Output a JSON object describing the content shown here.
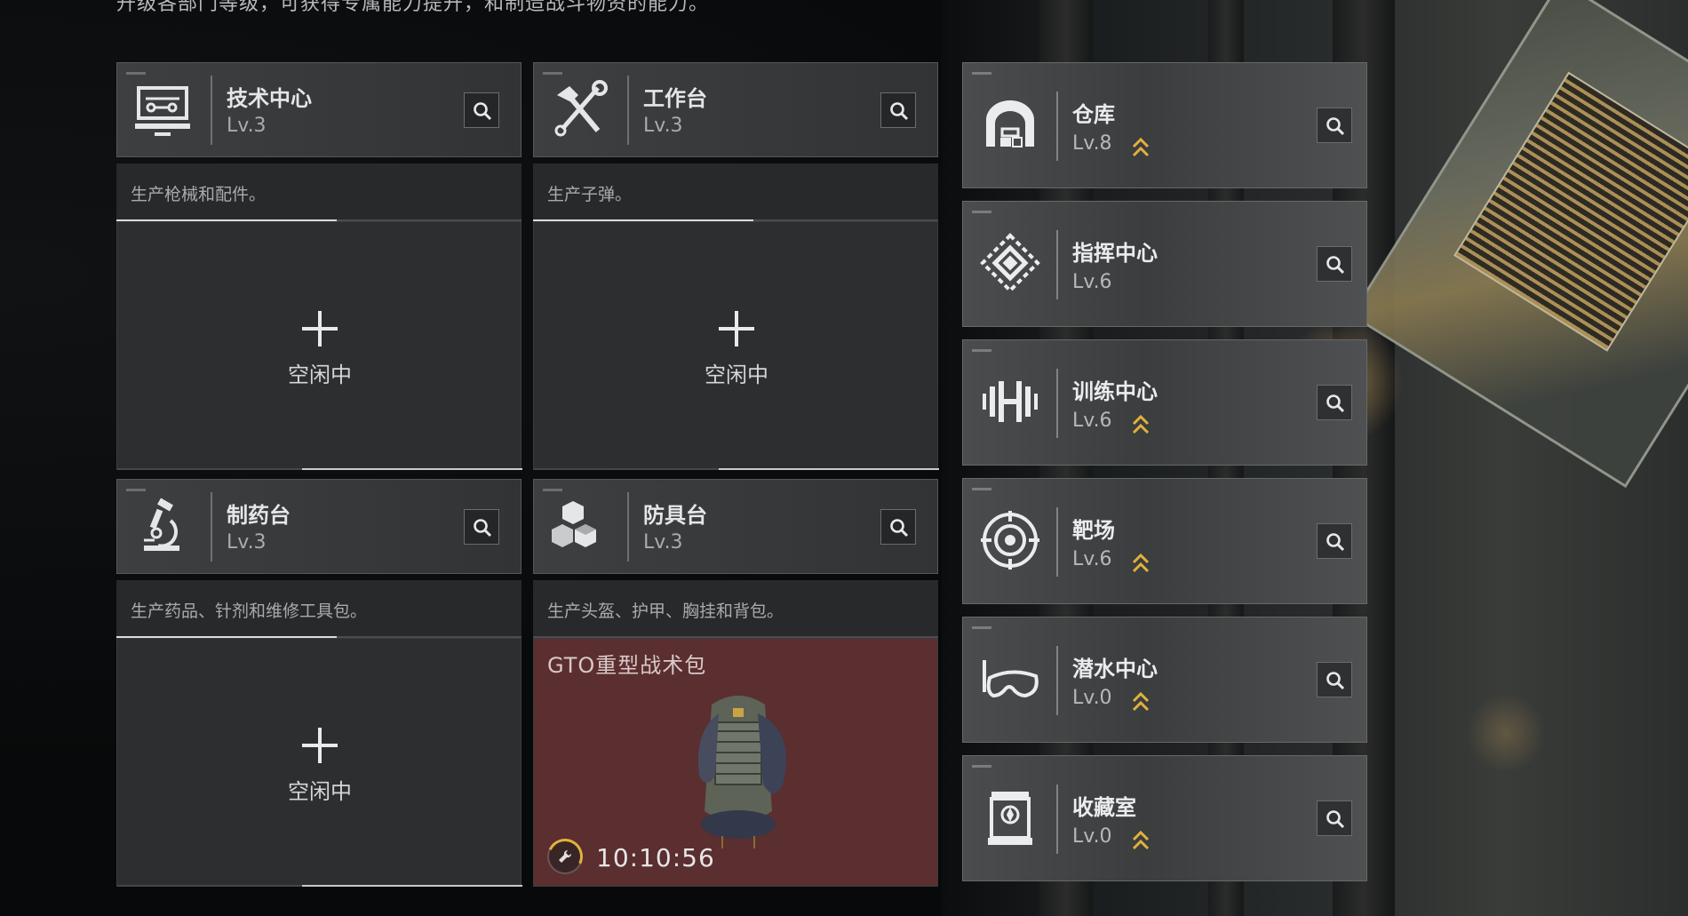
{
  "header": {
    "subtitle": "升级各部门等级，可获得专属能力提升，和制造战斗物资的能力。"
  },
  "production": [
    {
      "name": "技术中心",
      "level": "Lv.3",
      "description": "生产枪械和配件。",
      "status": "空闲中",
      "icon": "computer-icon"
    },
    {
      "name": "工作台",
      "level": "Lv.3",
      "description": "生产子弹。",
      "status": "空闲中",
      "icon": "tools-icon"
    },
    {
      "name": "制药台",
      "level": "Lv.3",
      "description": "生产药品、针剂和维修工具包。",
      "status": "空闲中",
      "icon": "microscope-icon"
    },
    {
      "name": "防具台",
      "level": "Lv.3",
      "description": "生产头盔、护甲、胸挂和背包。",
      "item": "GTO重型战术包",
      "timer": "10:10:56",
      "icon": "boxes-icon"
    }
  ],
  "facilities": [
    {
      "name": "仓库",
      "level": "Lv.8",
      "upgradable": true,
      "icon": "warehouse-icon"
    },
    {
      "name": "指挥中心",
      "level": "Lv.6",
      "upgradable": false,
      "icon": "command-icon"
    },
    {
      "name": "训练中心",
      "level": "Lv.6",
      "upgradable": true,
      "icon": "dumbbell-icon"
    },
    {
      "name": "靶场",
      "level": "Lv.6",
      "upgradable": true,
      "icon": "target-icon"
    },
    {
      "name": "潜水中心",
      "level": "Lv.0",
      "upgradable": true,
      "icon": "goggles-icon"
    },
    {
      "name": "收藏室",
      "level": "Lv.0",
      "upgradable": true,
      "icon": "collection-icon"
    }
  ],
  "colors": {
    "upgrade_accent": "#e0b23a",
    "active_card": "#5b2e30"
  }
}
